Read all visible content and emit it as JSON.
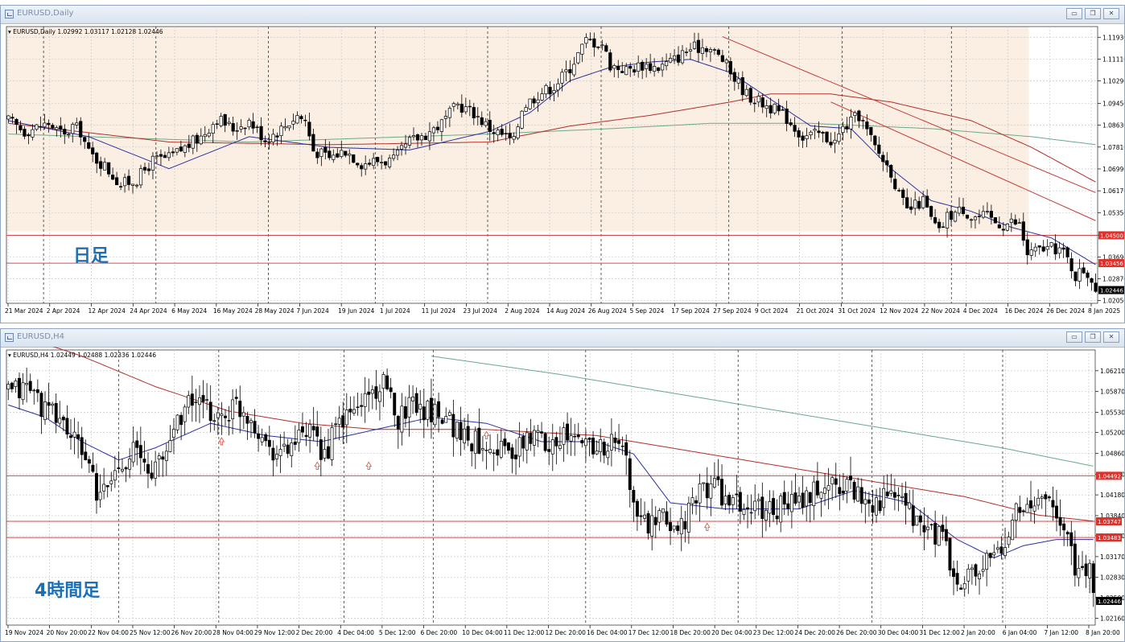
{
  "colors": {
    "bg": "#ffffff",
    "shade": "#fbefe4",
    "grid": "#c9c9c9",
    "candle": "#000000",
    "ma_blue": "#2b2f9e",
    "ma_red": "#b0302a",
    "ma_green": "#6aaa8a",
    "hline": "#d44a4a",
    "trend": "#c53a36",
    "label_red": "#e0302a",
    "label_black": "#000000",
    "annot": "#1d6fb5",
    "arrow": "#e05c4a"
  },
  "daily": {
    "window_title": "EURUSD,Daily",
    "info_line": "EURUSD,Daily  1.02992 1.03117 1.02128 1.02446",
    "annotation": "日足",
    "price_ticks": [
      "1.11930",
      "1.11110",
      "1.10290",
      "1.09450",
      "1.08630",
      "1.07810",
      "1.06990",
      "1.06170",
      "1.05350",
      "1.04500",
      "1.03690",
      "1.02870",
      "1.02050"
    ],
    "price_labels": [
      {
        "text": "1.04500",
        "kind": "red"
      },
      {
        "text": "1.03456",
        "kind": "red"
      },
      {
        "text": "1.02446",
        "kind": "black"
      }
    ],
    "date_ticks": [
      "21 Mar 2024",
      "2 Apr 2024",
      "12 Apr 2024",
      "24 Apr 2024",
      "6 May 2024",
      "16 May 2024",
      "28 May 2024",
      "7 Jun 2024",
      "19 Jun 2024",
      "1 Jul 2024",
      "11 Jul 2024",
      "23 Jul 2024",
      "2 Aug 2024",
      "14 Aug 2024",
      "26 Aug 2024",
      "5 Sep 2024",
      "17 Sep 2024",
      "27 Sep 2024",
      "9 Oct 2024",
      "21 Oct 2024",
      "31 Oct 2024",
      "12 Nov 2024",
      "22 Nov 2024",
      "4 Dec 2024",
      "16 Dec 2024",
      "26 Dec 2024",
      "8 Jan 2025"
    ],
    "hlines": [
      1.045,
      1.03456
    ],
    "y_range": [
      1.0195,
      1.1233
    ],
    "price_anchors": [
      [
        0,
        1.088
      ],
      [
        4,
        1.084
      ],
      [
        10,
        1.087
      ],
      [
        14,
        1.082
      ],
      [
        16,
        1.086
      ],
      [
        18,
        1.084
      ],
      [
        20,
        1.076
      ],
      [
        24,
        1.071
      ],
      [
        28,
        1.064
      ],
      [
        32,
        1.066
      ],
      [
        36,
        1.073
      ],
      [
        40,
        1.074
      ],
      [
        44,
        1.078
      ],
      [
        48,
        1.082
      ],
      [
        52,
        1.089
      ],
      [
        56,
        1.085
      ],
      [
        60,
        1.088
      ],
      [
        64,
        1.081
      ],
      [
        68,
        1.085
      ],
      [
        72,
        1.09
      ],
      [
        74,
        1.088
      ],
      [
        76,
        1.077
      ],
      [
        80,
        1.074
      ],
      [
        84,
        1.077
      ],
      [
        88,
        1.072
      ],
      [
        92,
        1.073
      ],
      [
        96,
        1.073
      ],
      [
        100,
        1.08
      ],
      [
        104,
        1.083
      ],
      [
        108,
        1.087
      ],
      [
        112,
        1.094
      ],
      [
        116,
        1.091
      ],
      [
        120,
        1.085
      ],
      [
        124,
        1.082
      ],
      [
        126,
        1.08
      ],
      [
        128,
        1.093
      ],
      [
        132,
        1.098
      ],
      [
        136,
        1.101
      ],
      [
        140,
        1.108
      ],
      [
        144,
        1.118
      ],
      [
        148,
        1.117
      ],
      [
        150,
        1.109
      ],
      [
        154,
        1.107
      ],
      [
        158,
        1.109
      ],
      [
        162,
        1.108
      ],
      [
        166,
        1.111
      ],
      [
        170,
        1.115
      ],
      [
        174,
        1.116
      ],
      [
        178,
        1.111
      ],
      [
        180,
        1.106
      ],
      [
        184,
        1.098
      ],
      [
        186,
        1.096
      ],
      [
        190,
        1.093
      ],
      [
        194,
        1.089
      ],
      [
        198,
        1.082
      ],
      [
        202,
        1.083
      ],
      [
        206,
        1.08
      ],
      [
        208,
        1.085
      ],
      [
        212,
        1.09
      ],
      [
        216,
        1.078
      ],
      [
        220,
        1.069
      ],
      [
        222,
        1.06
      ],
      [
        224,
        1.054
      ],
      [
        228,
        1.058
      ],
      [
        230,
        1.051
      ],
      [
        232,
        1.046
      ],
      [
        234,
        1.052
      ],
      [
        238,
        1.055
      ],
      [
        240,
        1.052
      ],
      [
        244,
        1.052
      ],
      [
        246,
        1.05
      ],
      [
        248,
        1.049
      ],
      [
        250,
        1.05
      ],
      [
        252,
        1.049
      ],
      [
        254,
        1.038
      ],
      [
        258,
        1.04
      ],
      [
        262,
        1.04
      ],
      [
        264,
        1.036
      ],
      [
        266,
        1.03
      ],
      [
        268,
        1.032
      ],
      [
        270,
        1.029
      ],
      [
        271,
        1.0245
      ]
    ],
    "ma_blue_anchors": [
      [
        0,
        1.088
      ],
      [
        20,
        1.082
      ],
      [
        40,
        1.07
      ],
      [
        60,
        1.082
      ],
      [
        80,
        1.078
      ],
      [
        100,
        1.077
      ],
      [
        120,
        1.084
      ],
      [
        130,
        1.091
      ],
      [
        140,
        1.103
      ],
      [
        150,
        1.108
      ],
      [
        160,
        1.11
      ],
      [
        170,
        1.111
      ],
      [
        180,
        1.106
      ],
      [
        190,
        1.096
      ],
      [
        200,
        1.086
      ],
      [
        210,
        1.085
      ],
      [
        220,
        1.07
      ],
      [
        230,
        1.058
      ],
      [
        240,
        1.054
      ],
      [
        250,
        1.048
      ],
      [
        260,
        1.044
      ],
      [
        271,
        1.034
      ]
    ],
    "ma_red_anchors": [
      [
        0,
        1.087
      ],
      [
        40,
        1.08
      ],
      [
        80,
        1.079
      ],
      [
        120,
        1.08
      ],
      [
        140,
        1.086
      ],
      [
        160,
        1.09
      ],
      [
        180,
        1.095
      ],
      [
        190,
        1.098
      ],
      [
        205,
        1.098
      ],
      [
        220,
        1.095
      ],
      [
        240,
        1.088
      ],
      [
        255,
        1.078
      ],
      [
        271,
        1.065
      ]
    ],
    "ma_green_anchors": [
      [
        0,
        1.083
      ],
      [
        60,
        1.08
      ],
      [
        120,
        1.083
      ],
      [
        150,
        1.085
      ],
      [
        175,
        1.087
      ],
      [
        200,
        1.087
      ],
      [
        230,
        1.085
      ],
      [
        255,
        1.082
      ],
      [
        271,
        1.079
      ]
    ],
    "trendlines": [
      [
        [
          178,
          1.1195
        ],
        [
          271,
          1.061
        ]
      ],
      [
        [
          205,
          1.095
        ],
        [
          271,
          1.0505
        ]
      ]
    ]
  },
  "h4": {
    "window_title": "EURUSD,H4",
    "info_line": "EURUSD,H4  1.02449 1.02488 1.02336 1.02446",
    "annotation": "4時間足",
    "price_ticks": [
      "1.06210",
      "1.05870",
      "1.05530",
      "1.05200",
      "1.04860",
      "1.04520",
      "1.04180",
      "1.03840",
      "1.03510",
      "1.03170",
      "1.02830",
      "1.02500",
      "1.02160"
    ],
    "price_labels": [
      {
        "text": "1.04492",
        "kind": "red"
      },
      {
        "text": "1.03747",
        "kind": "red"
      },
      {
        "text": "1.03483",
        "kind": "red"
      },
      {
        "text": "1.02446",
        "kind": "black"
      }
    ],
    "date_ticks": [
      "19 Nov 2024",
      "20 Nov 20:00",
      "22 Nov 04:00",
      "25 Nov 12:00",
      "26 Nov 20:00",
      "28 Nov 04:00",
      "29 Nov 12:00",
      "2 Dec 20:00",
      "4 Dec 04:00",
      "5 Dec 12:00",
      "6 Dec 20:00",
      "10 Dec 04:00",
      "11 Dec 12:00",
      "12 Dec 20:00",
      "16 Dec 04:00",
      "17 Dec 12:00",
      "18 Dec 20:00",
      "20 Dec 04:00",
      "23 Dec 12:00",
      "24 Dec 20:00",
      "26 Dec 20:00",
      "30 Dec 04:00",
      "31 Dec 12:00",
      "2 Jan 20:00",
      "6 Jan 04:00",
      "7 Jan 12:00",
      "8 Jan 20:00"
    ],
    "hlines": [
      1.04492,
      1.03747,
      1.03483
    ],
    "y_range": [
      1.0205,
      1.0655
    ],
    "price_anchors": [
      [
        0,
        1.0585
      ],
      [
        6,
        1.0595
      ],
      [
        10,
        1.0555
      ],
      [
        14,
        1.0545
      ],
      [
        18,
        1.0505
      ],
      [
        22,
        1.0475
      ],
      [
        24,
        1.0405
      ],
      [
        26,
        1.0425
      ],
      [
        30,
        1.0465
      ],
      [
        34,
        1.0495
      ],
      [
        38,
        1.0455
      ],
      [
        42,
        1.0475
      ],
      [
        46,
        1.0545
      ],
      [
        50,
        1.0575
      ],
      [
        54,
        1.0555
      ],
      [
        58,
        1.0545
      ],
      [
        62,
        1.0565
      ],
      [
        66,
        1.0545
      ],
      [
        70,
        1.0505
      ],
      [
        74,
        1.0485
      ],
      [
        78,
        1.0505
      ],
      [
        82,
        1.0515
      ],
      [
        86,
        1.0485
      ],
      [
        90,
        1.0535
      ],
      [
        94,
        1.0555
      ],
      [
        98,
        1.0585
      ],
      [
        102,
        1.0595
      ],
      [
        106,
        1.0545
      ],
      [
        110,
        1.0575
      ],
      [
        114,
        1.0555
      ],
      [
        118,
        1.0555
      ],
      [
        122,
        1.0525
      ],
      [
        126,
        1.0505
      ],
      [
        130,
        1.0505
      ],
      [
        134,
        1.0495
      ],
      [
        138,
        1.0485
      ],
      [
        142,
        1.0515
      ],
      [
        146,
        1.0505
      ],
      [
        150,
        1.0515
      ],
      [
        154,
        1.0505
      ],
      [
        158,
        1.0505
      ],
      [
        162,
        1.0495
      ],
      [
        166,
        1.0505
      ],
      [
        168,
        1.0475
      ],
      [
        170,
        1.0395
      ],
      [
        174,
        1.0365
      ],
      [
        178,
        1.0375
      ],
      [
        182,
        1.0365
      ],
      [
        186,
        1.0395
      ],
      [
        188,
        1.0425
      ],
      [
        192,
        1.0435
      ],
      [
        196,
        1.0405
      ],
      [
        200,
        1.0395
      ],
      [
        204,
        1.0395
      ],
      [
        208,
        1.0395
      ],
      [
        212,
        1.0405
      ],
      [
        216,
        1.0405
      ],
      [
        220,
        1.0425
      ],
      [
        224,
        1.0435
      ],
      [
        228,
        1.0435
      ],
      [
        232,
        1.0415
      ],
      [
        236,
        1.0405
      ],
      [
        240,
        1.0415
      ],
      [
        244,
        1.0395
      ],
      [
        248,
        1.0365
      ],
      [
        252,
        1.0355
      ],
      [
        254,
        1.0345
      ],
      [
        258,
        1.0265
      ],
      [
        262,
        1.0285
      ],
      [
        266,
        1.0305
      ],
      [
        270,
        1.0325
      ],
      [
        272,
        1.0345
      ],
      [
        274,
        1.0415
      ],
      [
        278,
        1.0385
      ],
      [
        282,
        1.0425
      ],
      [
        284,
        1.0385
      ],
      [
        288,
        1.0355
      ],
      [
        290,
        1.0305
      ],
      [
        292,
        1.0285
      ],
      [
        294,
        1.0305
      ],
      [
        295,
        1.0245
      ]
    ],
    "ma_blue_anchors": [
      [
        0,
        1.0565
      ],
      [
        10,
        1.0545
      ],
      [
        20,
        1.0505
      ],
      [
        30,
        1.0475
      ],
      [
        40,
        1.0495
      ],
      [
        55,
        1.0535
      ],
      [
        70,
        1.0515
      ],
      [
        85,
        1.0505
      ],
      [
        100,
        1.0525
      ],
      [
        115,
        1.0545
      ],
      [
        130,
        1.0535
      ],
      [
        145,
        1.0505
      ],
      [
        160,
        1.0505
      ],
      [
        170,
        1.0485
      ],
      [
        180,
        1.0405
      ],
      [
        195,
        1.0395
      ],
      [
        215,
        1.0395
      ],
      [
        230,
        1.0425
      ],
      [
        245,
        1.0405
      ],
      [
        258,
        1.0345
      ],
      [
        268,
        1.0315
      ],
      [
        276,
        1.0335
      ],
      [
        285,
        1.0345
      ],
      [
        295,
        1.0345
      ]
    ],
    "ma_red_anchors": [
      [
        0,
        1.0685
      ],
      [
        20,
        1.0645
      ],
      [
        40,
        1.0595
      ],
      [
        60,
        1.0555
      ],
      [
        80,
        1.0535
      ],
      [
        100,
        1.0525
      ],
      [
        130,
        1.0525
      ],
      [
        160,
        1.0515
      ],
      [
        180,
        1.0495
      ],
      [
        200,
        1.0475
      ],
      [
        230,
        1.0445
      ],
      [
        260,
        1.0415
      ],
      [
        280,
        1.0385
      ],
      [
        295,
        1.0375
      ]
    ],
    "ma_green_anchors": [
      [
        115,
        1.0645
      ],
      [
        150,
        1.0615
      ],
      [
        180,
        1.0585
      ],
      [
        210,
        1.0555
      ],
      [
        240,
        1.0525
      ],
      [
        270,
        1.0495
      ],
      [
        295,
        1.0465
      ]
    ],
    "trendlines": []
  }
}
